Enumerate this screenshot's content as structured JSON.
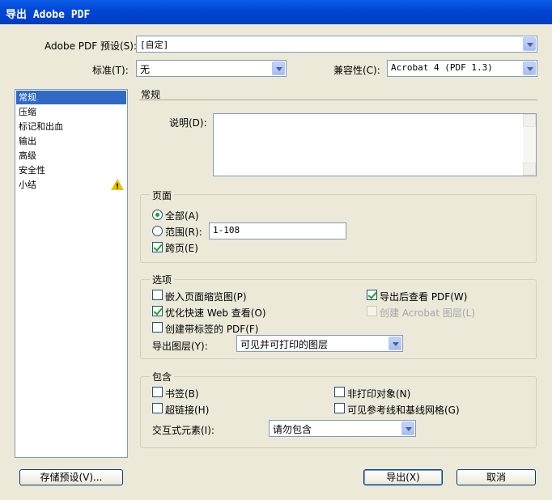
{
  "window": {
    "title": "导出 Adobe PDF"
  },
  "preset": {
    "label": "Adobe PDF 预设(S):",
    "value": "[自定]"
  },
  "standard": {
    "label": "标准(T):",
    "value": "无"
  },
  "compat": {
    "label": "兼容性(C):",
    "value": "Acrobat 4 (PDF 1.3)"
  },
  "sidebar": {
    "items": [
      {
        "label": "常规",
        "selected": true
      },
      {
        "label": "压缩"
      },
      {
        "label": "标记和出血"
      },
      {
        "label": "输出"
      },
      {
        "label": "高级"
      },
      {
        "label": "安全性"
      },
      {
        "label": "小结",
        "icon": "warning-icon"
      }
    ]
  },
  "section": {
    "title": "常规"
  },
  "description": {
    "label": "说明(D):",
    "value": ""
  },
  "pages": {
    "title": "页面",
    "all_label": "全部(A)",
    "range_label": "范围(R):",
    "range_value": "1-108",
    "spreads_label": "跨页(E)"
  },
  "options": {
    "title": "选项",
    "embed_thumbs": "嵌入页面缩览图(P)",
    "view_after": "导出后查看 PDF(W)",
    "optimize": "优化快速 Web 查看(O)",
    "acrobat_layers": "创建 Acrobat 图层(L)",
    "tagged": "创建带标签的 PDF(F)",
    "export_layers_label": "导出图层(Y):",
    "export_layers_value": "可见并可打印的图层"
  },
  "include": {
    "title": "包含",
    "bookmarks": "书签(B)",
    "nonprinting": "非打印对象(N)",
    "hyperlinks": "超链接(H)",
    "guides": "可见参考线和基线网格(G)",
    "interactive_label": "交互式元素(I):",
    "interactive_value": "请勿包含"
  },
  "buttons": {
    "save_preset": "存储预设(V)...",
    "export": "导出(X)",
    "cancel": "取消"
  }
}
